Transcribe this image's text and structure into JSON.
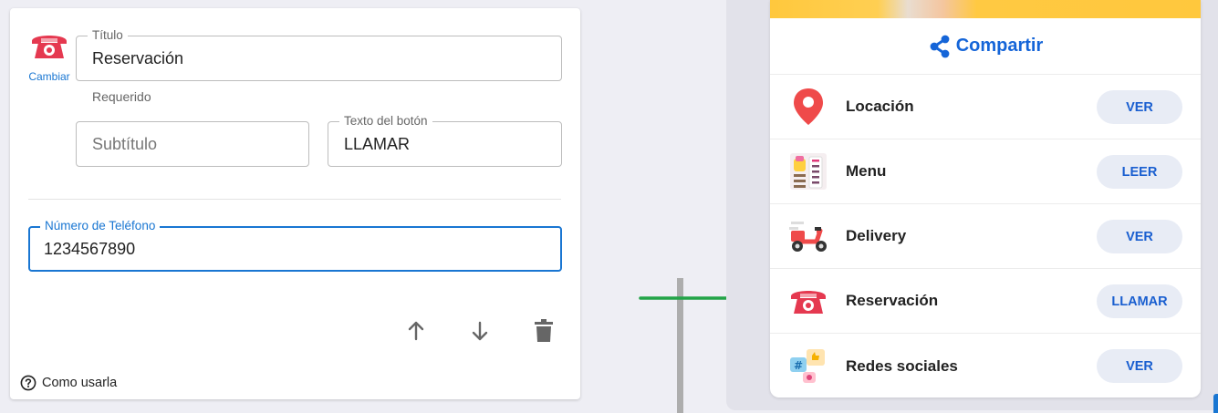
{
  "editor": {
    "change_label": "Cambiar",
    "title_field": {
      "label": "Título",
      "value": "Reservación"
    },
    "title_helper": "Requerido",
    "subtitle_field": {
      "placeholder": "Subtítulo",
      "value": ""
    },
    "button_text_field": {
      "label": "Texto del botón",
      "value": "LLAMAR"
    },
    "phone_field": {
      "label": "Número de Teléfono",
      "value": "1234567890"
    },
    "help_label": "Como usarla"
  },
  "preview": {
    "share_label": "Compartir",
    "rows": [
      {
        "label": "Locación",
        "button": "VER",
        "icon": "location-pin-icon"
      },
      {
        "label": "Menu",
        "button": "LEER",
        "icon": "menu-icon"
      },
      {
        "label": "Delivery",
        "button": "VER",
        "icon": "scooter-icon"
      },
      {
        "label": "Reservación",
        "button": "LLAMAR",
        "icon": "telephone-icon"
      },
      {
        "label": "Redes sociales",
        "button": "VER",
        "icon": "social-media-icon"
      }
    ]
  },
  "colors": {
    "accent": "#1976d2",
    "link_blue": "#1565d8",
    "button_bg": "#e8ecf5",
    "phone_red": "#e53950",
    "arrow_green": "#22a447"
  }
}
